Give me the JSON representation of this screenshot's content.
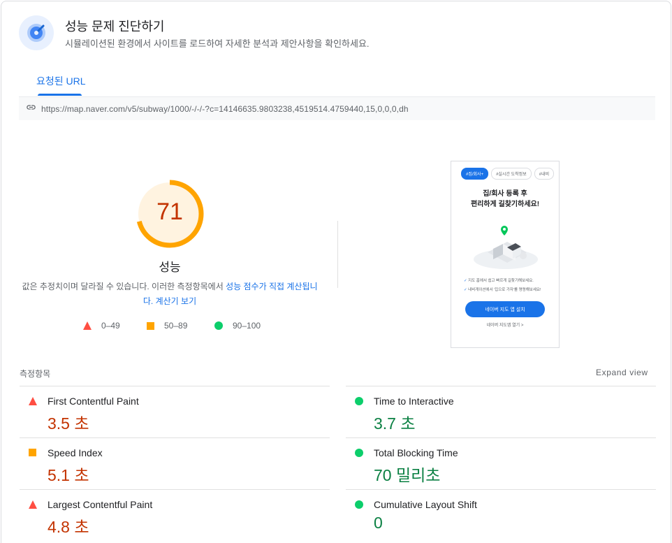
{
  "header": {
    "title": "성능 문제 진단하기",
    "subtitle": "시뮬레이션된 환경에서 사이트를 로드하여 자세한 분석과 제안사항을 확인하세요."
  },
  "tabs": [
    {
      "label": "요청된 URL",
      "active": true
    }
  ],
  "url": "https://map.naver.com/v5/subway/1000/-/-/-?c=14146635.9803238,4519514.4759440,15,0,0,0,dh",
  "score": {
    "value": "71",
    "fraction": 0.71,
    "label": "성능",
    "description_prefix": "값은 추정치이며 달라질 수 있습니다. 이러한 측정항목에서 ",
    "description_link": "성능 점수가 직접 계산됩니다.",
    "description_link2": "계산기 보기",
    "color": "#ffa400",
    "text_color": "#c33300"
  },
  "legend": [
    {
      "shape": "triangle",
      "range": "0–49",
      "color": "#ff4e42"
    },
    {
      "shape": "square",
      "range": "50–89",
      "color": "#ffa400"
    },
    {
      "shape": "circle",
      "range": "90–100",
      "color": "#0cce6b"
    }
  ],
  "screenshot": {
    "chips": [
      "#집/회사+",
      "#실시간 도착정보",
      "#내비"
    ],
    "headline_line1": "집/회사 등록 후",
    "headline_line2": "편리하게 길찾기하세요!",
    "checks": [
      "지도 홈에서 쉽고 빠르게 길찾기해보세요.",
      "내비게이션에서 '집으로 가자'를 명령해보세요!"
    ],
    "install_button": "네이버 지도 앱 설치",
    "open_link": "네이버 지도앱 열기 >"
  },
  "metrics_section": {
    "title": "측정항목",
    "expand_label": "Expand view"
  },
  "metrics": [
    {
      "name": "First Contentful Paint",
      "value": "3.5 초",
      "status": "fail"
    },
    {
      "name": "Time to Interactive",
      "value": "3.7 초",
      "status": "pass"
    },
    {
      "name": "Speed Index",
      "value": "5.1 초",
      "status": "average"
    },
    {
      "name": "Total Blocking Time",
      "value": "70 밀리초",
      "status": "pass"
    },
    {
      "name": "Largest Contentful Paint",
      "value": "4.8 초",
      "status": "fail"
    },
    {
      "name": "Cumulative Layout Shift",
      "value": "0",
      "status": "pass"
    }
  ],
  "icons": {
    "header": "lighthouse-gauge-icon",
    "url": "link-icon"
  }
}
